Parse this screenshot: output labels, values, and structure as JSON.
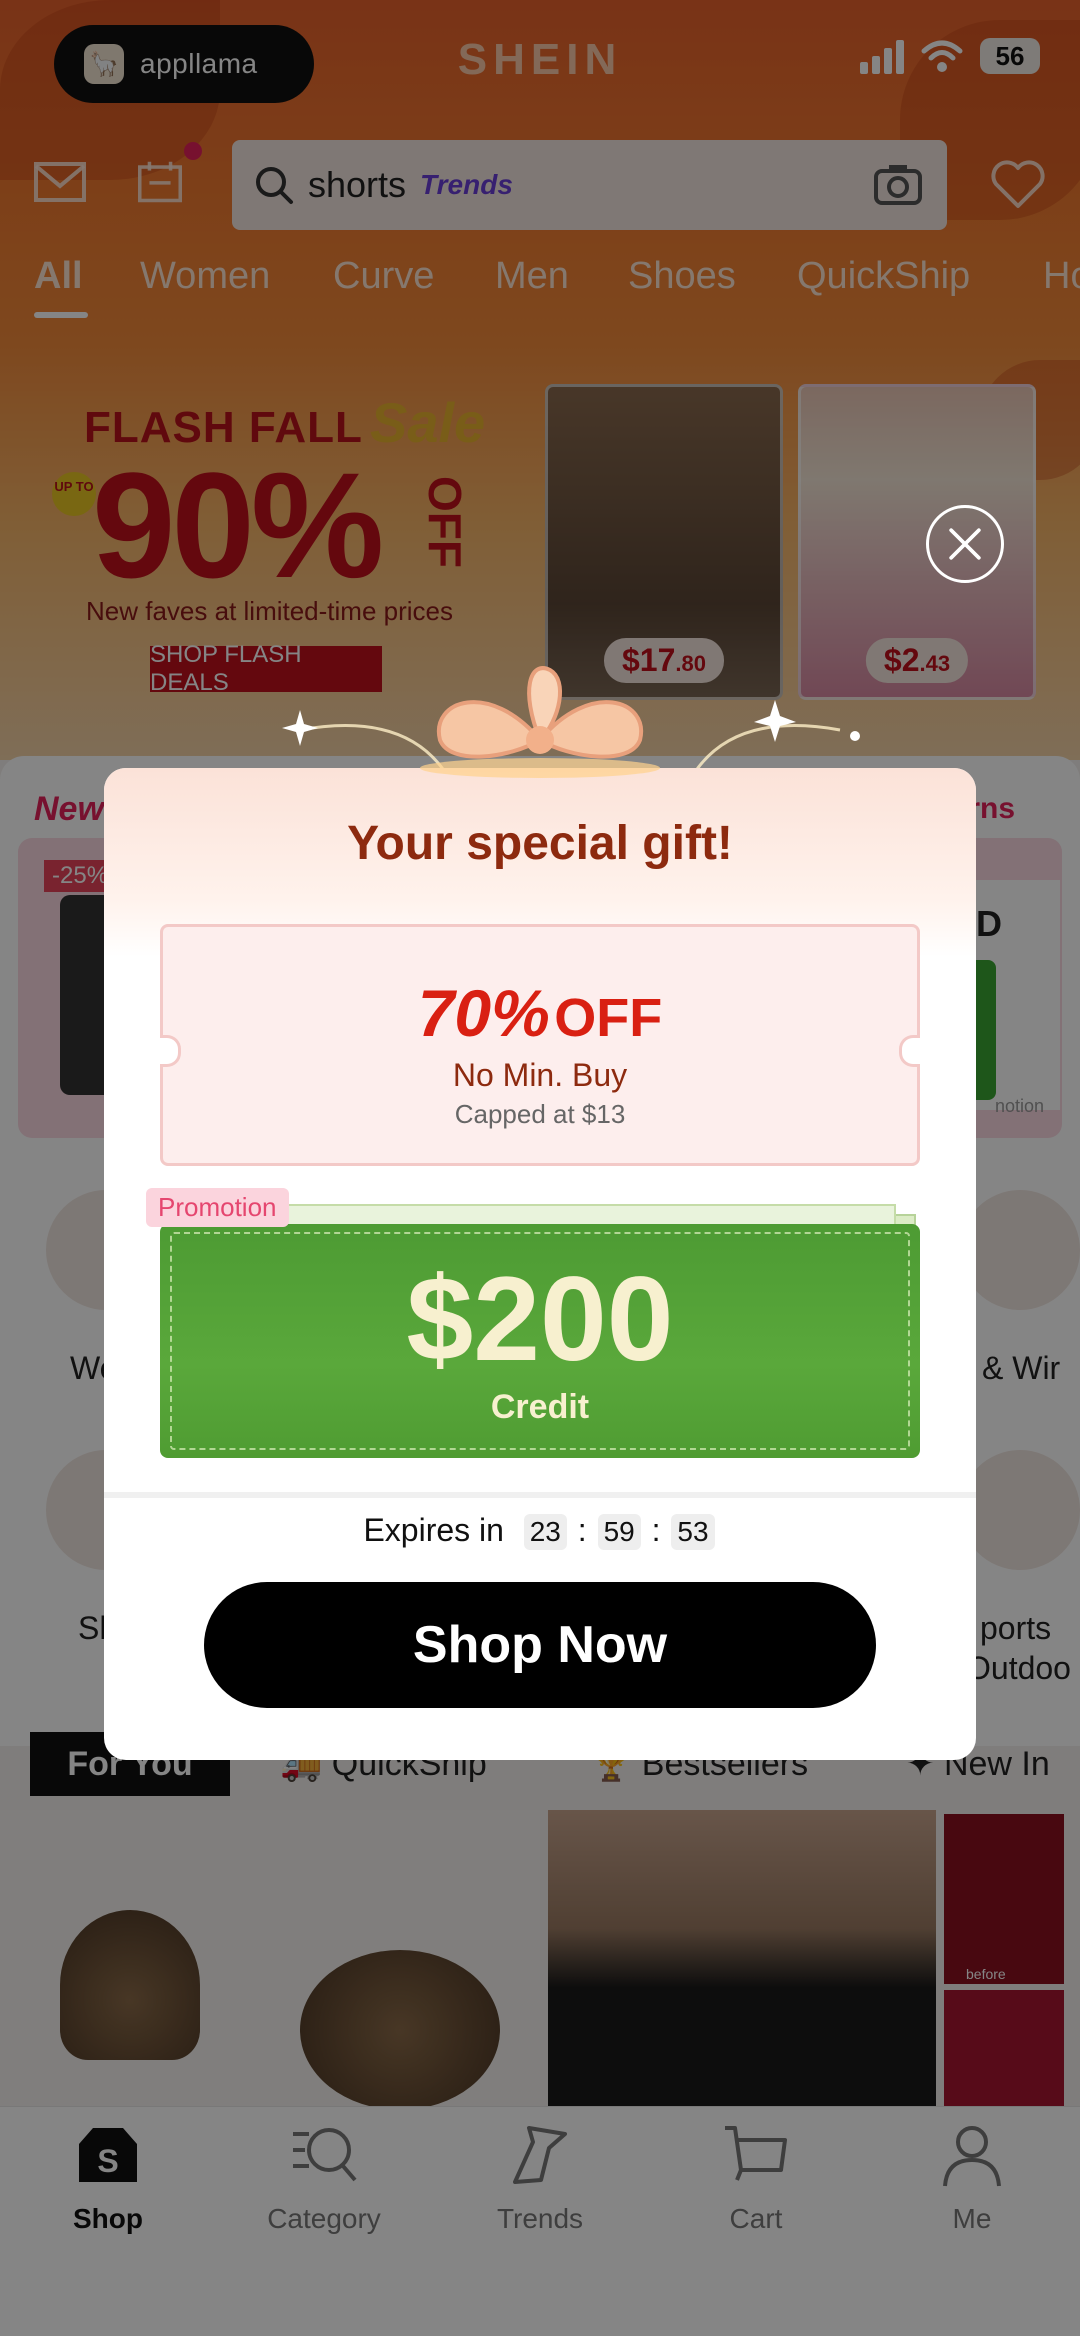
{
  "status_bar": {
    "app_name": "appllama",
    "battery": "56"
  },
  "header": {
    "brand": "SHEIN",
    "search_value": "shorts",
    "search_tag": "Trends",
    "tabs": [
      "All",
      "Women",
      "Curve",
      "Men",
      "Shoes",
      "QuickShip",
      "Ho"
    ]
  },
  "banner": {
    "flash_line": "FLASH FALL",
    "sale_word": "Sale",
    "up_to": "UP TO",
    "percent": "90%",
    "off": "OFF",
    "tagline": "New faves at limited-time prices",
    "button": "SHOP FLASH DEALS",
    "product1_price": "$17",
    "product1_cents": ".80",
    "product2_price": "$2",
    "product2_cents": ".43"
  },
  "mid": {
    "new_label": "New",
    "returns_label": "urns",
    "discount_badge": "-25%",
    "card_text": "RD",
    "card_footer": "notion",
    "categories_row1": [
      "We",
      "l & Wir"
    ],
    "categories_row2": [
      "Sh",
      "ports",
      "Outdoo"
    ]
  },
  "feed_tabs": {
    "for_you": "For You",
    "quickship": "QuickShip",
    "bestsellers": "Bestsellers",
    "new_in": "New In",
    "before_label": "before"
  },
  "bottom_nav": [
    {
      "label": "Shop"
    },
    {
      "label": "Category"
    },
    {
      "label": "Trends"
    },
    {
      "label": "Cart"
    },
    {
      "label": "Me"
    }
  ],
  "modal": {
    "title": "Your special gift!",
    "coupon_pct": "70%",
    "coupon_off": "OFF",
    "coupon_min": "No Min. Buy",
    "coupon_cap": "Capped at $13",
    "promo_tag": "Promotion",
    "credit_amount": "$200",
    "credit_label": "Credit",
    "expires_label": "Expires in",
    "countdown": {
      "hours": "23",
      "minutes": "59",
      "seconds": "53",
      "sep": ":"
    },
    "cta": "Shop Now"
  },
  "colors": {
    "accent": "#e5225b",
    "coupon_red": "#d92012",
    "credit_green": "#5aa83b",
    "title_brown": "#8d2a0f"
  }
}
